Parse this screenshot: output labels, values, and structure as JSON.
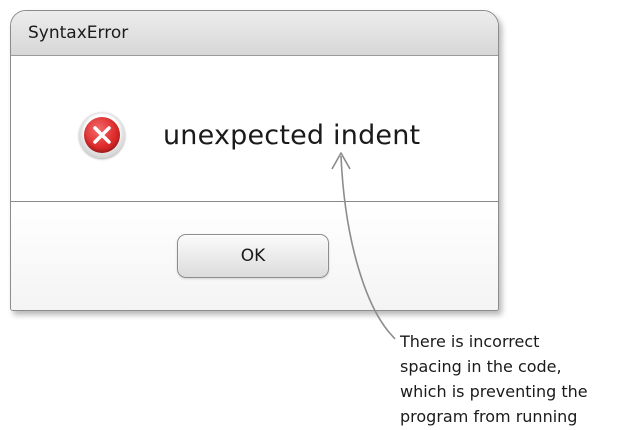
{
  "dialog": {
    "title": "SyntaxError",
    "message": "unexpected indent",
    "icon": "error-x-icon",
    "ok_label": "OK"
  },
  "annotation": {
    "lines": [
      "There is incorrect",
      "spacing in the code,",
      "which is preventing the",
      "program from running"
    ]
  },
  "colors": {
    "error_red": "#dd2a2a",
    "titlebar": "#e2e2e2",
    "arrow": "#8c8c8c"
  }
}
